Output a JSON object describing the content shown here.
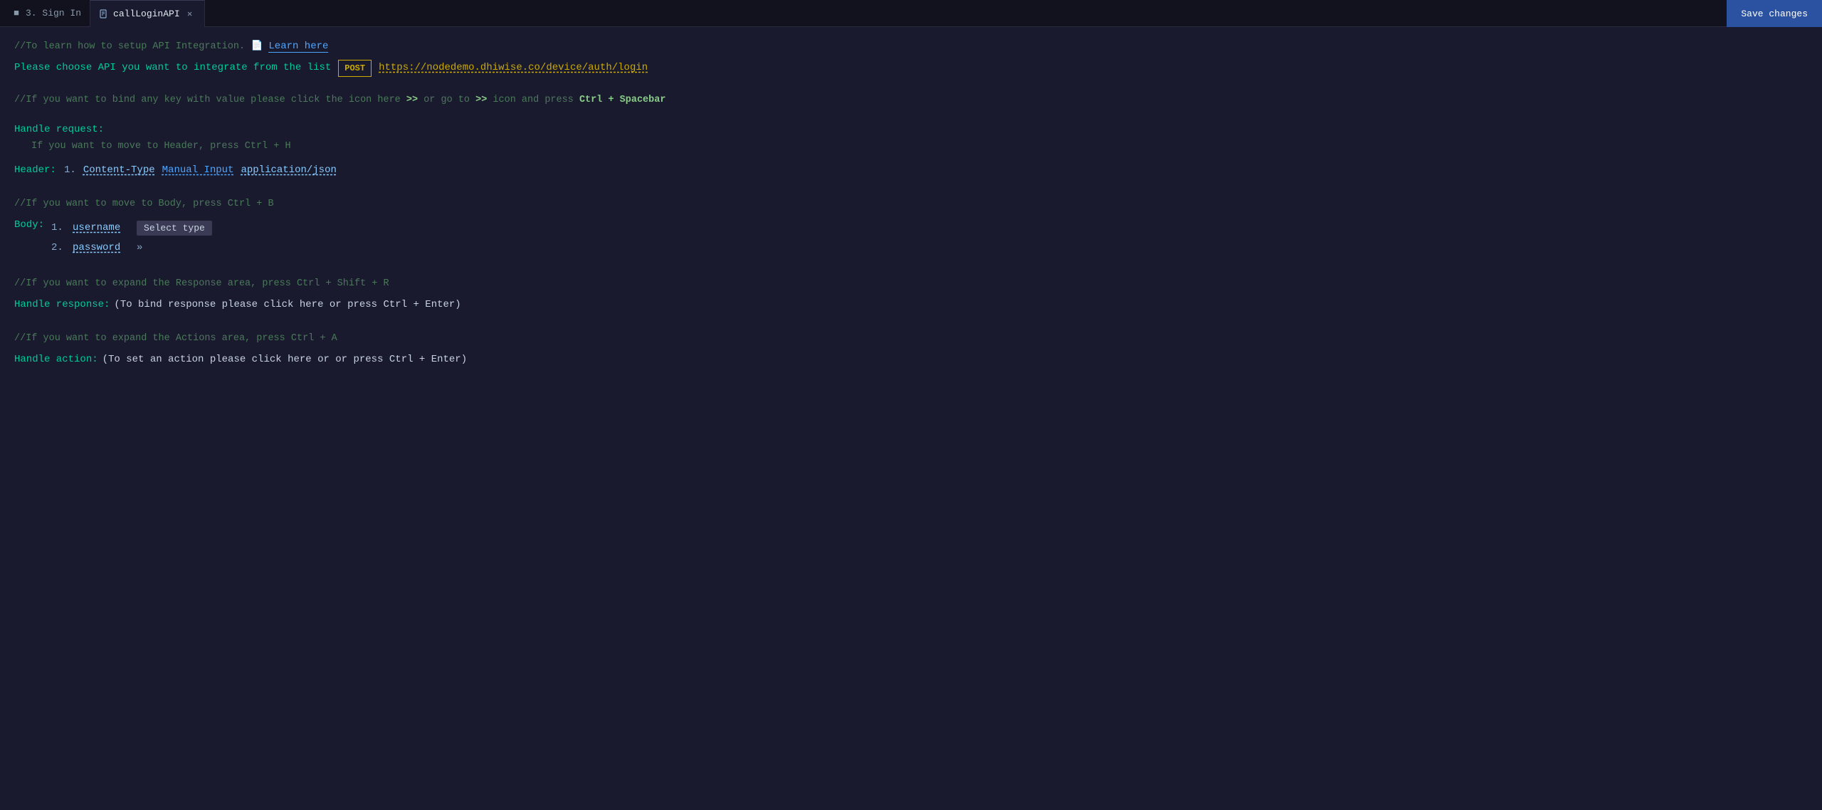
{
  "tabs": [
    {
      "id": "sign-in",
      "label": "3. Sign In",
      "icon": "step-icon",
      "active": false,
      "closable": false
    },
    {
      "id": "call-login-api",
      "label": "callLoginAPI",
      "icon": "file-icon",
      "active": true,
      "closable": true
    }
  ],
  "save_button_label": "Save changes",
  "top_comment": "//To learn how to setup API Integration.",
  "learn_link_label": "Learn here",
  "api_select_prompt": "Please choose API you want to integrate from the list",
  "api_method": "POST",
  "api_url": "https://nodedemo.dhiwise.co/device/auth/login",
  "bind_hint": "//If you want to bind any key with value please click the icon here >> or go to >> icon and press Ctrl + Spacebar",
  "handle_request_label": "Handle request:",
  "header_move_hint": "If you want to move to Header, press Ctrl + H",
  "header_label": "Header:",
  "header_items": [
    {
      "num": "1.",
      "key": "Content-Type",
      "type_label": "Manual Input",
      "value": "application/json"
    }
  ],
  "body_move_hint": "//If you want to move to Body, press Ctrl + B",
  "body_label": "Body:",
  "body_items": [
    {
      "num": "1.",
      "key": "username",
      "select_label": "Select type",
      "has_chevron": false
    },
    {
      "num": "2.",
      "key": "password",
      "select_label": null,
      "has_chevron": true
    }
  ],
  "response_expand_hint": "//If you want to expand the Response area, press Ctrl + Shift + R",
  "handle_response_label": "Handle response:",
  "handle_response_text": "(To bind response please click here or press Ctrl + Enter)",
  "action_expand_hint": "//If you want to expand the Actions area, press Ctrl + A",
  "handle_action_label": "Handle action:",
  "handle_action_text": "(To set an action please click here or or press Ctrl + Enter)",
  "colors": {
    "comment": "#4a7a5a",
    "teal": "#00cc99",
    "blue_link": "#4da6ff",
    "yellow": "#ccaa00",
    "light_blue": "#88ccff",
    "bg": "#1a1a2e",
    "tab_bar": "#12121f"
  }
}
